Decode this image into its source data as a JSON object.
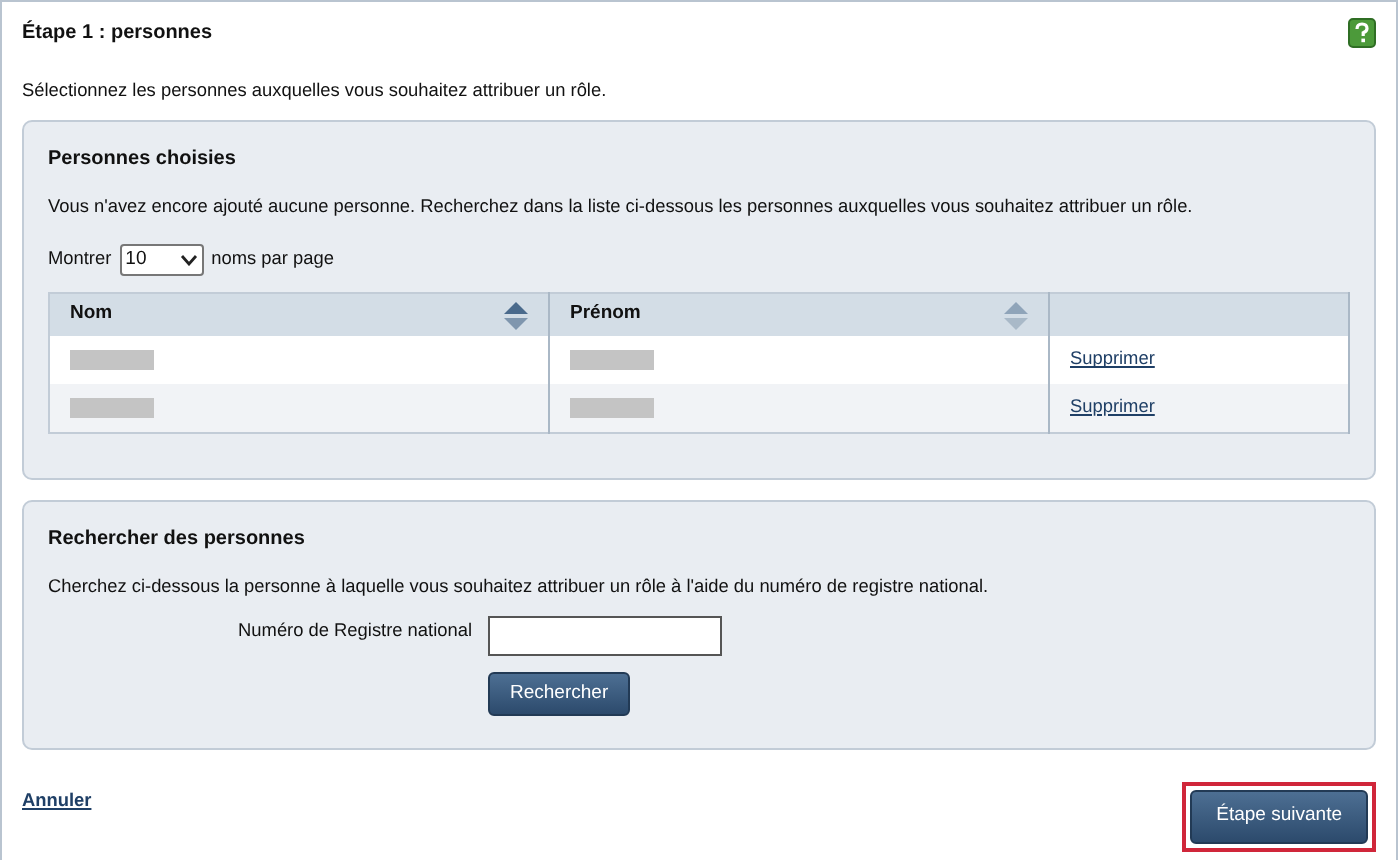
{
  "title": "Étape 1 : personnes",
  "intro": "Sélectionnez les personnes auxquelles vous souhaitez attribuer un rôle.",
  "chosen": {
    "heading": "Personnes choisies",
    "message": "Vous n'avez encore ajouté aucune personne. Recherchez dans la liste ci-dessous les personnes auxquelles vous souhaitez attribuer un rôle.",
    "page_size": {
      "before": "Montrer",
      "value": "10",
      "after": "noms par page"
    },
    "columns": [
      {
        "label": "Nom",
        "sorted": true
      },
      {
        "label": "Prénom",
        "sorted": false
      },
      {}
    ],
    "rows": [
      {
        "nom": {
          "kind": "redacted"
        },
        "prenom": {
          "kind": "redacted"
        },
        "action": "Supprimer"
      },
      {
        "nom": {
          "kind": "redacted"
        },
        "prenom": {
          "kind": "redacted"
        },
        "action": "Supprimer"
      }
    ]
  },
  "search": {
    "heading": "Rechercher des personnes",
    "message": "Cherchez ci-dessous la personne à laquelle vous souhaitez attribuer un rôle à l'aide du numéro de registre national.",
    "field_label": "Numéro de Registre national",
    "button": "Rechercher"
  },
  "cancel": "Annuler",
  "next": {
    "label": "Étape suivante",
    "highlighted": true
  }
}
